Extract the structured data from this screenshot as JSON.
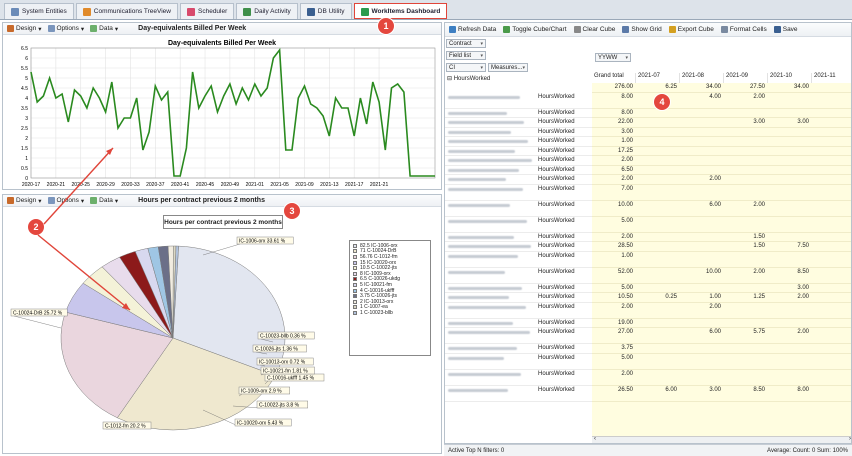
{
  "tabs": [
    {
      "label": "System Entities",
      "icon": "grid-icon",
      "color": "#6b8bb8"
    },
    {
      "label": "Communications TreeView",
      "icon": "tree-icon",
      "color": "#e08a2a"
    },
    {
      "label": "Scheduler",
      "icon": "calendar-icon",
      "color": "#d84a6c"
    },
    {
      "label": "Daily Activity",
      "icon": "activity-icon",
      "color": "#3f8f4a"
    },
    {
      "label": "DB Utility",
      "icon": "database-icon",
      "color": "#3a5f90"
    },
    {
      "label": "WorkItems Dashboard",
      "icon": "dashboard-icon",
      "color": "#2b9a4d"
    }
  ],
  "badges": [
    "1",
    "2",
    "3",
    "4"
  ],
  "line_panel": {
    "design_label": "Design",
    "options_label": "Options",
    "data_label": "Data",
    "title": "Day-equivalents Billed Per Week"
  },
  "pie_panel": {
    "design_label": "Design",
    "options_label": "Options",
    "data_label": "Data",
    "title": "Hours per contract previous 2 months"
  },
  "chart_data": [
    {
      "type": "line",
      "title": "Day-equivalents Billed Per Week",
      "color": "#2a8a1f",
      "ylim": [
        0,
        6.5
      ],
      "y_ticks": [
        "0",
        "0.5",
        "1",
        "1.5",
        "2",
        "2.5",
        "3",
        "3.5",
        "4",
        "4.5",
        "5",
        "5.5",
        "6",
        "6.5"
      ],
      "x_ticks": [
        "2020-17",
        "2020-21",
        "2020-25",
        "2020-29",
        "2020-33",
        "2020-37",
        "2020-41",
        "2020-45",
        "2020-49",
        "2021-01",
        "2021-05",
        "2021-09",
        "2021-13",
        "2021-17",
        "2021-21"
      ],
      "values": [
        5.3,
        3.8,
        4.1,
        5.0,
        4.0,
        4.2,
        2.8,
        4.4,
        4.1,
        3.5,
        4.5,
        4.0,
        3.3,
        4.8,
        2.5,
        3.0,
        3.0,
        4.0,
        1.4,
        2.3,
        4.6,
        3.9,
        4.3,
        0.1,
        0.1,
        1.5,
        5.3,
        3.5,
        4.1,
        4.6,
        3.3,
        4.1,
        4.7,
        3.7,
        4.5,
        3.9,
        4.7,
        4.1,
        4.5,
        6.0,
        6.4,
        1.4,
        1.4,
        4.0,
        4.6,
        3.7,
        3.5,
        3.1,
        2.1,
        4.0,
        3.5,
        3.5,
        2.1,
        4.0,
        2.7,
        4.8,
        3.8,
        1.4,
        4.5,
        4.7,
        4.3,
        0.1,
        0.1,
        0.1,
        0.1,
        0.1
      ]
    },
    {
      "type": "pie",
      "title": "Hours per contract previous 2 months",
      "categories": [
        "IC-1006-orx",
        "IC-10024-DrB",
        "C-1012-fm",
        "IC-10020-orx",
        "IC-10022-jts",
        "IC-1009-orx",
        "IC-10026-ukdg",
        "IC-10021-fm",
        "C-10016-ukfff",
        "C-10026-jts",
        "IC-10013-orx",
        "C-1007-ea",
        "C-10023-bllb"
      ],
      "values": [
        82.5,
        71,
        56.76,
        15,
        10.5,
        8,
        6.5,
        5,
        4,
        3.75,
        2,
        1,
        1
      ],
      "legend": [
        "82.5 IC-1006-orx",
        "71 C-10024-DrB",
        "56.76 C-1012-fm",
        "15 IC-10020-orx",
        "10.5 C-10022-jts",
        "8 IC-1009-orx",
        "6.5 C-10026-ukdg",
        "5 IC-10021-fm",
        "4 C-10016-ukfff",
        "3.75 C-10026-jts",
        "2 IC-10013-orx",
        "1 C-1007-ea",
        "1 C-10023-bllb"
      ],
      "slice_labels": [
        "IC-1006-orx 33.61 %",
        "C-10024-DrB 25.72 %",
        "C-1012-fm 20.2 %",
        "IC-10020-orx 5.43 %",
        "C-10022-jts 3.8 %",
        "IC-1009-orx 2.9 %",
        "C-10016-ukfff 1.45 %",
        "IC-10021-fm 1.81 %",
        "IC-10013-orx 0.72 %",
        "C-10026-jts 1.36 %",
        "C-10023-bllb 0.36 %"
      ],
      "colors": [
        "#e2e6f0",
        "#efe8cf",
        "#ead6de",
        "#c8c6ec",
        "#f4f2d8",
        "#e8dcec",
        "#8c1a1a",
        "#d8d8ef",
        "#9fc6e4",
        "#6b6f88",
        "#f1ece0",
        "#dbd7c4",
        "#b3c4de"
      ]
    }
  ],
  "pivot": {
    "toolbar": [
      "Refresh Data",
      "Toggle Cube/Chart",
      "Clear Cube",
      "Show Grid",
      "Export Cube",
      "Format Cells",
      "Save"
    ],
    "contract_label": "Contract",
    "fieldlist_label": "Field list",
    "ci_label": "CI",
    "measures_label": "Measures...",
    "yyww_label": "YYWW",
    "root_label": "HoursWorked",
    "measure": "HoursWorked",
    "col_headers": [
      "Grand total",
      "2021-07",
      "2021-08",
      "2021-09",
      "2021-10",
      "2021-11"
    ],
    "rows": [
      [
        "276.00",
        "6.25",
        "34.00",
        "27.50",
        "34.00",
        ""
      ],
      [
        "8.00",
        "",
        "4.00",
        "2.00",
        "",
        ""
      ],
      [
        "8.00",
        "",
        "",
        "",
        "",
        ""
      ],
      [
        "22.00",
        "",
        "",
        "3.00",
        "3.00",
        ""
      ],
      [
        "3.00",
        "",
        "",
        "",
        "",
        ""
      ],
      [
        "1.00",
        "",
        "",
        "",
        "",
        ""
      ],
      [
        "17.25",
        "",
        "",
        "",
        "",
        ""
      ],
      [
        "2.00",
        "",
        "",
        "",
        "",
        ""
      ],
      [
        "6.50",
        "",
        "",
        "",
        "",
        ""
      ],
      [
        "2.00",
        "",
        "2.00",
        "",
        "",
        ""
      ],
      [
        "7.00",
        "",
        "",
        "",
        "",
        ""
      ],
      [
        "10.00",
        "",
        "6.00",
        "2.00",
        "",
        ""
      ],
      [
        "5.00",
        "",
        "",
        "",
        "",
        ""
      ],
      [
        "2.00",
        "",
        "",
        "1.50",
        "",
        ""
      ],
      [
        "28.50",
        "",
        "",
        "1.50",
        "7.50",
        ""
      ],
      [
        "1.00",
        "",
        "",
        "",
        "",
        ""
      ],
      [
        "52.00",
        "",
        "10.00",
        "2.00",
        "8.50",
        ""
      ],
      [
        "5.00",
        "",
        "",
        "",
        "3.00",
        ""
      ],
      [
        "10.50",
        "0.25",
        "1.00",
        "1.25",
        "2.00",
        ""
      ],
      [
        "2.00",
        "",
        "2.00",
        "",
        "",
        ""
      ],
      [
        "19.00",
        "",
        "",
        "",
        "",
        ""
      ],
      [
        "27.00",
        "",
        "6.00",
        "5.75",
        "2.00",
        ""
      ],
      [
        "3.75",
        "",
        "",
        "",
        "",
        ""
      ],
      [
        "5.00",
        "",
        "",
        "",
        "",
        ""
      ],
      [
        "2.00",
        "",
        "",
        "",
        "",
        ""
      ],
      [
        "26.50",
        "6.00",
        "3.00",
        "8.50",
        "8.00",
        ""
      ]
    ],
    "status_left": "Active Top N filters: 0",
    "status_right": "Average:  Count: 0  Sum:  100%"
  }
}
